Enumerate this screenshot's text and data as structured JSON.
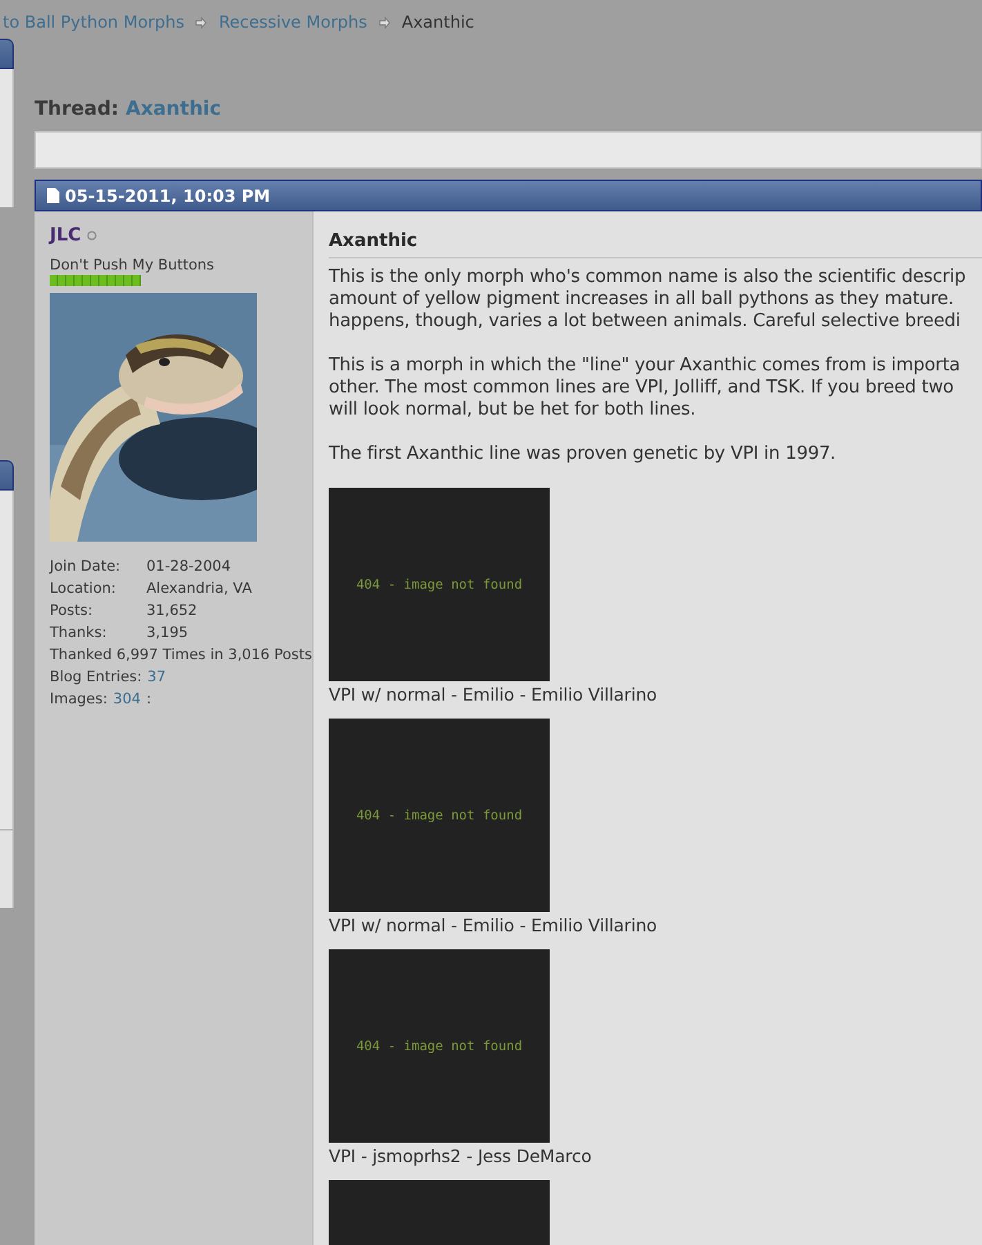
{
  "breadcrumb": [
    {
      "label": "to Ball Python Morphs",
      "kind": "link"
    },
    {
      "label": "Recessive Morphs",
      "kind": "link"
    },
    {
      "label": "Axanthic",
      "kind": "current"
    }
  ],
  "thread": {
    "prefix": "Thread:",
    "title": "Axanthic"
  },
  "post": {
    "date": "05-15-2011, 10:03 PM",
    "user": {
      "name": "JLC",
      "online": false,
      "title": "Don't Push My Buttons",
      "reputation": {
        "level": 1
      },
      "details": [
        {
          "kind": "pair",
          "label": "Join Date:",
          "value": "01-28-2004"
        },
        {
          "kind": "pair",
          "label": "Location:",
          "value": "Alexandria, VA"
        },
        {
          "kind": "pair",
          "label": "Posts:",
          "value": "31,652"
        },
        {
          "kind": "pair",
          "label": "Thanks:",
          "value": "3,195"
        },
        {
          "kind": "line",
          "text": "Thanked 6,997 Times in 3,016 Posts"
        },
        {
          "kind": "link",
          "label": "Blog Entries:",
          "value": "37"
        },
        {
          "kind": "link",
          "label": "Images:",
          "value": "304",
          "suffix": ":"
        }
      ]
    },
    "title": "Axanthic",
    "paragraphs": [
      [
        "This is the only morph who's common name is also the scientific descrip",
        "amount of yellow pigment increases in all ball pythons as they mature.",
        "happens, though, varies a lot between animals. Careful selective breedi"
      ],
      [
        "This is a morph in which the \"line\" your Axanthic comes from is importa",
        "other. The most common lines are VPI, Jolliff, and TSK. If you breed two",
        "will look normal, but be het for both lines."
      ],
      [
        "The first Axanthic line was proven genetic by VPI in 1997."
      ]
    ],
    "images": [
      {
        "kind": "broken",
        "message": "404 - image not found",
        "caption": "VPI w/ normal - Emilio - Emilio Villarino"
      },
      {
        "kind": "broken",
        "message": "404 - image not found",
        "caption": "VPI w/ normal - Emilio - Emilio Villarino"
      },
      {
        "kind": "broken",
        "message": "404 - image not found",
        "caption": "VPI - jsmoprhs2 - Jess DeMarco"
      },
      {
        "kind": "cut"
      }
    ]
  }
}
